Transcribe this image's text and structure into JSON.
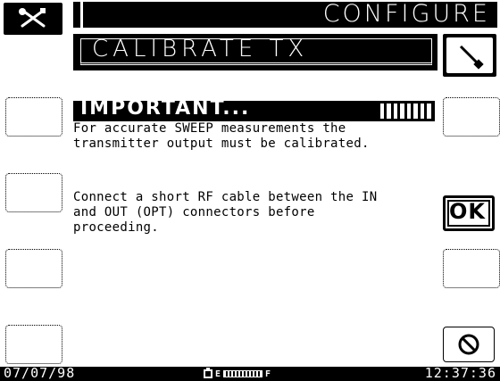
{
  "header": {
    "title": "CONFIGURE"
  },
  "subheader": {
    "title": "CALIBRATE TX"
  },
  "panel": {
    "heading": "IMPORTANT...",
    "message_1": "For accurate SWEEP measurements the\ntransmitter output must be calibrated.",
    "message_2": "Connect a short RF cable between the IN\nand OUT (OPT) connectors before\nproceeding."
  },
  "buttons": {
    "ok_label": "OK"
  },
  "icons": {
    "tools": "tools-icon",
    "probe": "probe-icon",
    "cancel": "cancel-icon",
    "battery": "battery-icon"
  },
  "status": {
    "date": "07/07/98",
    "time": "12:37:36",
    "battery_empty_label": "E",
    "battery_full_label": "F"
  }
}
